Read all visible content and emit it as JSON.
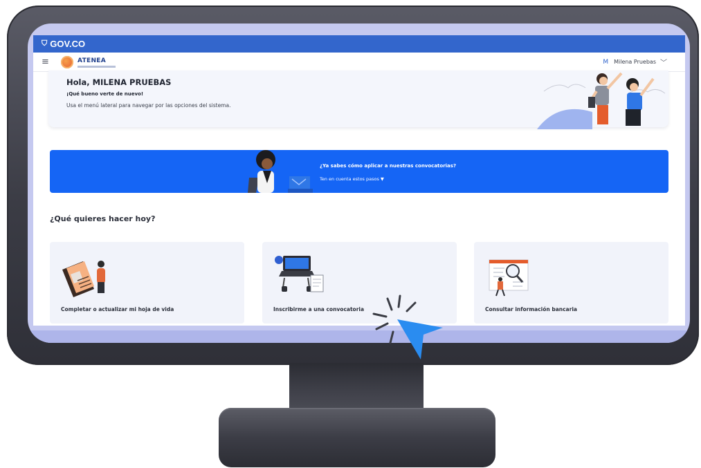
{
  "gov": {
    "brand": "GOV.CO"
  },
  "app": {
    "logo_text": "ATENEA",
    "user_initial": "M",
    "user_name": "Milena Pruebas"
  },
  "welcome": {
    "title": "Hola, MILENA PRUEBAS",
    "subtitle": "¡Qué bueno verte de nuevo!",
    "description": "Usa el menú lateral para navegar por las opciones del sistema."
  },
  "banner": {
    "question": "¿Ya sabes cómo aplicar a nuestras convocatorias?",
    "steps_label": "Ten en cuenta estos pasos ▼"
  },
  "section": {
    "title": "¿Qué quieres hacer hoy?"
  },
  "cards": [
    {
      "label": "Completar o actualizar mi hoja de vida",
      "icon": "resume-illustration-icon"
    },
    {
      "label": "Inscribirme a una convocatoria",
      "icon": "laptop-illustration-icon"
    },
    {
      "label": "Consultar información bancaria",
      "icon": "magnifier-illustration-icon"
    }
  ],
  "colors": {
    "gov_blue": "#3366cc",
    "banner_blue": "#1565f5",
    "card_bg": "#f1f3fa",
    "cursor_blue": "#2a8cf0"
  }
}
